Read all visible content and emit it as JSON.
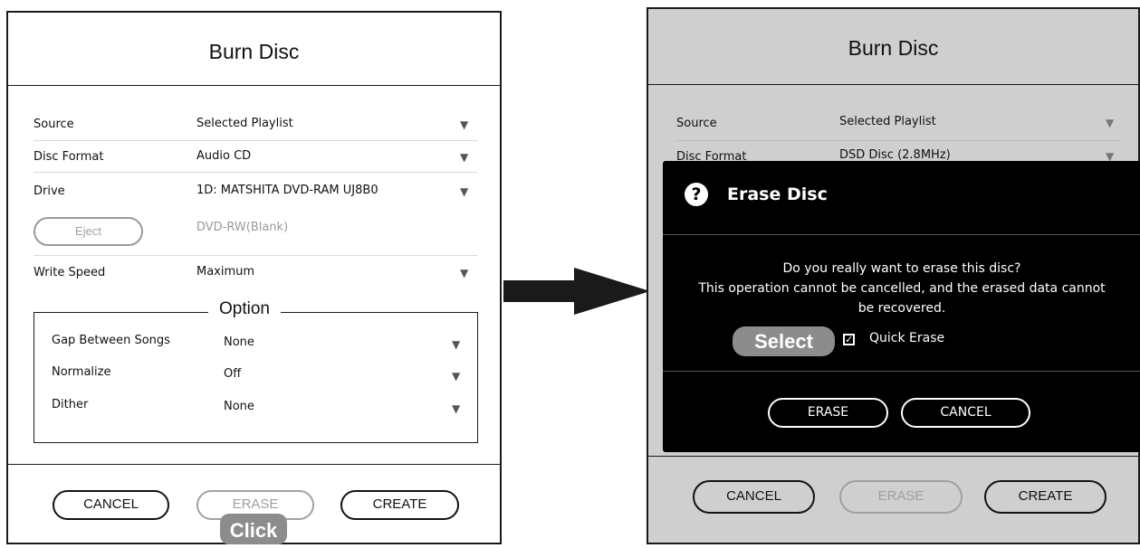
{
  "left": {
    "title": "Burn Disc",
    "rows": [
      {
        "label": "Source",
        "value": "Selected Playlist"
      },
      {
        "label": "Disc Format",
        "value": "Audio CD"
      },
      {
        "label": "Drive",
        "value": "1D: MATSHITA DVD-RAM UJ8B0"
      },
      {
        "label": "Write Speed",
        "value": "Maximum"
      }
    ],
    "eject_label": "Eject",
    "disc_status": "DVD-RW(Blank)",
    "option": {
      "legend": "Option",
      "rows": [
        {
          "label": "Gap Between Songs",
          "value": "None"
        },
        {
          "label": "Normalize",
          "value": "Off"
        },
        {
          "label": "Dither",
          "value": "None"
        }
      ]
    },
    "buttons": {
      "cancel": "CANCEL",
      "erase": "ERASE",
      "create": "CREATE"
    },
    "callout": "Click"
  },
  "right": {
    "title": "Burn Disc",
    "rows": [
      {
        "label": "Source",
        "value": "Selected Playlist"
      },
      {
        "label": "Disc Format",
        "value": "DSD Disc (2.8MHz)"
      }
    ],
    "buttons": {
      "cancel": "CANCEL",
      "erase": "ERASE",
      "create": "CREATE"
    }
  },
  "dialog": {
    "title": "Erase Disc",
    "icon": "question-icon",
    "message": [
      "Do you really want to erase this disc?",
      "This operation cannot be cancelled, and the erased data cannot",
      "be recovered."
    ],
    "checkbox_label": "Quick Erase",
    "checkbox_checked": true,
    "erase_label": "ERASE",
    "cancel_label": "CANCEL",
    "callout": "Select"
  },
  "dropdown_arrow": "▼",
  "colors": {
    "dialog_bg": "#000000",
    "callout_bg": "#8c8c8c",
    "dimmed_bg": "#cfcfcf",
    "disabled": "#a0a0a0"
  }
}
